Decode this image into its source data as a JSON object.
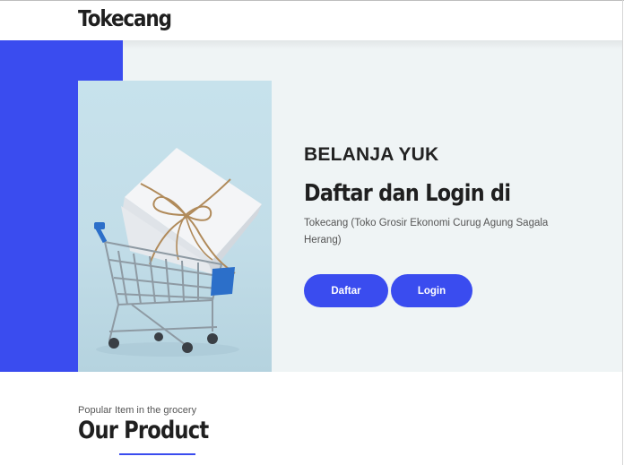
{
  "header": {
    "brand": "Tokecang"
  },
  "hero": {
    "kicker": "BELANJA YUK",
    "headline": "Daftar dan Login di",
    "description": "Tokecang (Toko Grosir Ekonomi Curug Agung Sagala Herang)",
    "buttons": {
      "daftar": "Daftar",
      "login": "Login"
    }
  },
  "products": {
    "subtitle": "Popular Item in the grocery",
    "title": "Our Product"
  },
  "colors": {
    "accent": "#3a4cef",
    "hero_bg": "#eff4f5",
    "text_dark": "#1f1f1f"
  },
  "icons": {
    "hero_image": "shopping-cart-with-gift-box"
  }
}
